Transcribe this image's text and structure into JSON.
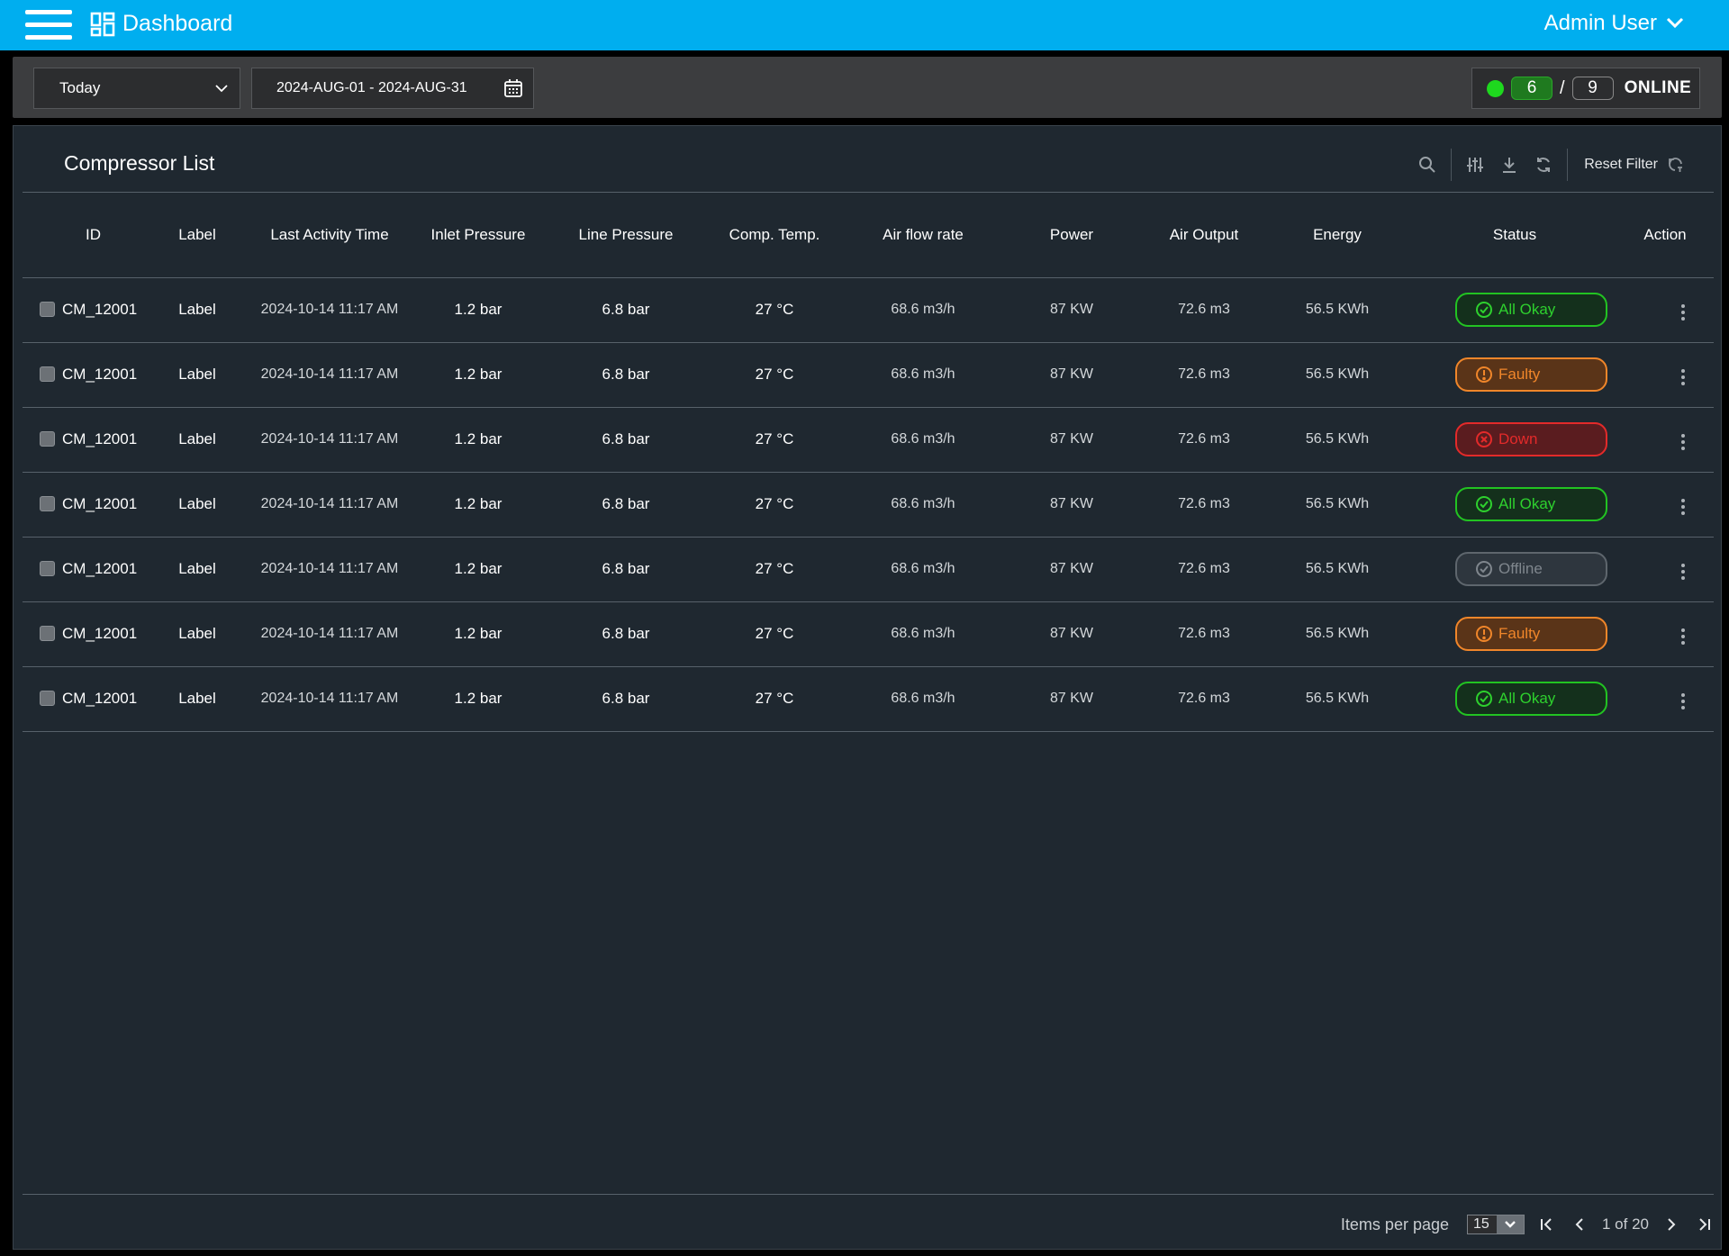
{
  "header": {
    "brand": "Dashboard",
    "user": "Admin User"
  },
  "filters": {
    "period": "Today",
    "date_range": "2024-AUG-01 - 2024-AUG-31",
    "online_count": "6",
    "total_count": "9",
    "online_label": "ONLINE",
    "online_color": "#1ed81e"
  },
  "panel": {
    "title": "Compressor List",
    "reset_filter": "Reset Filter"
  },
  "columns": [
    "ID",
    "Label",
    "Last Activity Time",
    "Inlet Pressure",
    "Line Pressure",
    "Comp. Temp.",
    "Air flow rate",
    "Power",
    "Air Output",
    "Energy",
    "Status",
    "Action"
  ],
  "rows": [
    {
      "id": "CM_12001",
      "label": "Label",
      "time": "2024-10-14 11:17 AM",
      "inlet": "1.2 bar",
      "line": "6.8 bar",
      "temp": "27 °C",
      "flow": "68.6 m3/h",
      "power": "87 KW",
      "output": "72.6 m3",
      "energy": "56.5 KWh",
      "status": "All Okay",
      "status_type": "ok"
    },
    {
      "id": "CM_12001",
      "label": "Label",
      "time": "2024-10-14 11:17 AM",
      "inlet": "1.2 bar",
      "line": "6.8 bar",
      "temp": "27 °C",
      "flow": "68.6 m3/h",
      "power": "87 KW",
      "output": "72.6 m3",
      "energy": "56.5 KWh",
      "status": "Faulty",
      "status_type": "faulty"
    },
    {
      "id": "CM_12001",
      "label": "Label",
      "time": "2024-10-14 11:17 AM",
      "inlet": "1.2 bar",
      "line": "6.8 bar",
      "temp": "27 °C",
      "flow": "68.6 m3/h",
      "power": "87 KW",
      "output": "72.6 m3",
      "energy": "56.5 KWh",
      "status": "Down",
      "status_type": "down"
    },
    {
      "id": "CM_12001",
      "label": "Label",
      "time": "2024-10-14 11:17 AM",
      "inlet": "1.2 bar",
      "line": "6.8 bar",
      "temp": "27 °C",
      "flow": "68.6 m3/h",
      "power": "87 KW",
      "output": "72.6 m3",
      "energy": "56.5 KWh",
      "status": "All Okay",
      "status_type": "ok"
    },
    {
      "id": "CM_12001",
      "label": "Label",
      "time": "2024-10-14 11:17 AM",
      "inlet": "1.2 bar",
      "line": "6.8 bar",
      "temp": "27 °C",
      "flow": "68.6 m3/h",
      "power": "87 KW",
      "output": "72.6 m3",
      "energy": "56.5 KWh",
      "status": "Offline",
      "status_type": "offline"
    },
    {
      "id": "CM_12001",
      "label": "Label",
      "time": "2024-10-14 11:17 AM",
      "inlet": "1.2 bar",
      "line": "6.8 bar",
      "temp": "27 °C",
      "flow": "68.6 m3/h",
      "power": "87 KW",
      "output": "72.6 m3",
      "energy": "56.5 KWh",
      "status": "Faulty",
      "status_type": "faulty"
    },
    {
      "id": "CM_12001",
      "label": "Label",
      "time": "2024-10-14 11:17 AM",
      "inlet": "1.2 bar",
      "line": "6.8 bar",
      "temp": "27 °C",
      "flow": "68.6 m3/h",
      "power": "87 KW",
      "output": "72.6 m3",
      "energy": "56.5 KWh",
      "status": "All Okay",
      "status_type": "ok"
    }
  ],
  "pagination": {
    "items_per_page_label": "Items per page",
    "items_per_page": "15",
    "page_label": "1 of 20"
  },
  "colors": {
    "topbar": "#00aeef",
    "ok": "#2ed12e",
    "faulty": "#f0862a",
    "down": "#e32a2a",
    "offline": "#7f868d"
  }
}
